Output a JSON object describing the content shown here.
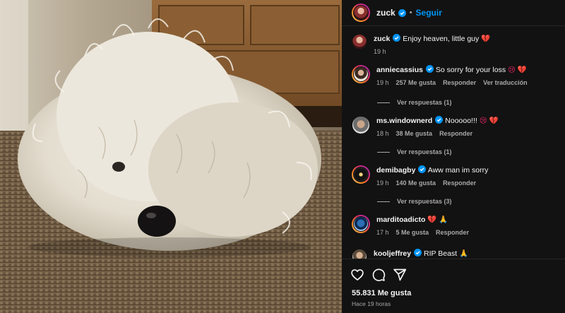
{
  "header": {
    "username": "zuck",
    "separator": "•",
    "follow_label": "Seguir"
  },
  "caption": {
    "username": "zuck",
    "text": "Enjoy heaven, little guy",
    "emoji": "💔",
    "time": "19 h"
  },
  "comments": [
    {
      "username": "anniecassius",
      "text": "So sorry for your loss",
      "emoji": "😢 💔",
      "time": "19 h",
      "likes": "257 Me gusta",
      "reply_label": "Responder",
      "translate_label": "Ver traducción",
      "view_replies": "Ver respuestas (1)"
    },
    {
      "username": "ms.windownerd",
      "text": "Nooooo!!!",
      "emoji": "😢 💔",
      "time": "18 h",
      "likes": "38 Me gusta",
      "reply_label": "Responder",
      "view_replies": "Ver respuestas (1)"
    },
    {
      "username": "demibagby",
      "text": "Aww man im sorry",
      "emoji": "",
      "time": "19 h",
      "likes": "140 Me gusta",
      "reply_label": "Responder",
      "view_replies": "Ver respuestas (3)"
    },
    {
      "username": "marditoadicto",
      "text": "",
      "emoji": "💔 🙏",
      "time": "17 h",
      "likes": "5 Me gusta",
      "reply_label": "Responder"
    },
    {
      "username": "kooljeffrey",
      "text": "RIP Beast",
      "emoji": "🙏"
    }
  ],
  "footer": {
    "likes": "55.831 Me gusta",
    "time": "Hace 19 horas"
  },
  "icons": {
    "like": "heart-icon",
    "comment": "comment-icon",
    "share": "share-icon",
    "verified": "verified-badge-icon"
  },
  "colors": {
    "panel_bg": "#121212",
    "link_blue": "#0095f6",
    "verified_blue": "#0095f6",
    "muted_text": "#a8a8a8"
  }
}
